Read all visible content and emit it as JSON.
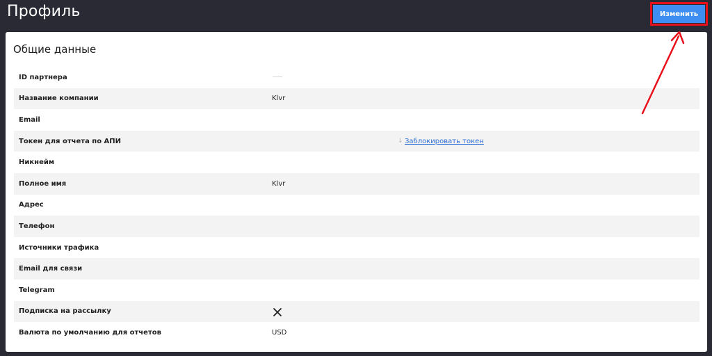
{
  "header": {
    "title": "Профиль",
    "edit_button": "Изменить"
  },
  "section": {
    "title": "Общие данные"
  },
  "rows": [
    {
      "label": "ID партнера",
      "value": ""
    },
    {
      "label": "Название компании",
      "value": "Klvr"
    },
    {
      "label": "Email",
      "value": ""
    },
    {
      "label": "Токен для отчета по АПИ",
      "value": "",
      "link": "Заблокировать токен"
    },
    {
      "label": "Никнейм",
      "value": ""
    },
    {
      "label": "Полное имя",
      "value": "Klvr"
    },
    {
      "label": "Адрес",
      "value": ""
    },
    {
      "label": "Телефон",
      "value": ""
    },
    {
      "label": "Источники трафика",
      "value": ""
    },
    {
      "label": "Email для связи",
      "value": ""
    },
    {
      "label": "Telegram",
      "value": ""
    },
    {
      "label": "Подписка на рассылку",
      "value": "",
      "icon": "close-icon"
    },
    {
      "label": "Валюта по умолчанию для отчетов",
      "value": "USD"
    }
  ],
  "colors": {
    "background": "#2a2a35",
    "card": "#ffffff",
    "row_alt": "#f3f3f3",
    "button": "#3d8ef0",
    "highlight": "#e8101a",
    "link": "#2f6fd6"
  }
}
